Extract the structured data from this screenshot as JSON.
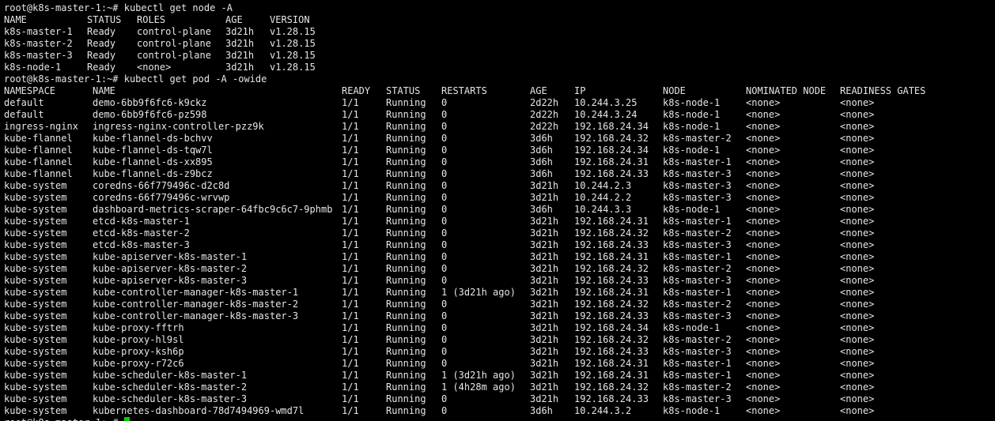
{
  "colors": {
    "background": "#000000",
    "foreground": "#e6e6e6",
    "cursor": "#00d000"
  },
  "prompt": "root@k8s-master-1:~#",
  "cmd_nodes": "kubectl get node -A",
  "node_table": {
    "headers": [
      "NAME",
      "STATUS",
      "ROLES",
      "AGE",
      "VERSION"
    ],
    "rows": [
      [
        "k8s-master-1",
        "Ready",
        "control-plane",
        "3d21h",
        "v1.28.15"
      ],
      [
        "k8s-master-2",
        "Ready",
        "control-plane",
        "3d21h",
        "v1.28.15"
      ],
      [
        "k8s-master-3",
        "Ready",
        "control-plane",
        "3d21h",
        "v1.28.15"
      ],
      [
        "k8s-node-1",
        "Ready",
        "<none>",
        "3d21h",
        "v1.28.15"
      ]
    ]
  },
  "cmd_pods": "kubectl get pod -A -owide",
  "pod_table": {
    "headers": [
      "NAMESPACE",
      "NAME",
      "READY",
      "STATUS",
      "RESTARTS",
      "AGE",
      "IP",
      "NODE",
      "NOMINATED NODE",
      "READINESS GATES"
    ],
    "rows": [
      [
        "default",
        "demo-6bb9f6fc6-k9ckz",
        "1/1",
        "Running",
        "0",
        "2d22h",
        "10.244.3.25",
        "k8s-node-1",
        "<none>",
        "<none>"
      ],
      [
        "default",
        "demo-6bb9f6fc6-pz598",
        "1/1",
        "Running",
        "0",
        "2d22h",
        "10.244.3.24",
        "k8s-node-1",
        "<none>",
        "<none>"
      ],
      [
        "ingress-nginx",
        "ingress-nginx-controller-pzz9k",
        "1/1",
        "Running",
        "0",
        "2d22h",
        "192.168.24.34",
        "k8s-node-1",
        "<none>",
        "<none>"
      ],
      [
        "kube-flannel",
        "kube-flannel-ds-bchvv",
        "1/1",
        "Running",
        "0",
        "3d6h",
        "192.168.24.32",
        "k8s-master-2",
        "<none>",
        "<none>"
      ],
      [
        "kube-flannel",
        "kube-flannel-ds-tqw7l",
        "1/1",
        "Running",
        "0",
        "3d6h",
        "192.168.24.34",
        "k8s-node-1",
        "<none>",
        "<none>"
      ],
      [
        "kube-flannel",
        "kube-flannel-ds-xx895",
        "1/1",
        "Running",
        "0",
        "3d6h",
        "192.168.24.31",
        "k8s-master-1",
        "<none>",
        "<none>"
      ],
      [
        "kube-flannel",
        "kube-flannel-ds-z9bcz",
        "1/1",
        "Running",
        "0",
        "3d6h",
        "192.168.24.33",
        "k8s-master-3",
        "<none>",
        "<none>"
      ],
      [
        "kube-system",
        "coredns-66f779496c-d2c8d",
        "1/1",
        "Running",
        "0",
        "3d21h",
        "10.244.2.3",
        "k8s-master-3",
        "<none>",
        "<none>"
      ],
      [
        "kube-system",
        "coredns-66f779496c-wrvwp",
        "1/1",
        "Running",
        "0",
        "3d21h",
        "10.244.2.2",
        "k8s-master-3",
        "<none>",
        "<none>"
      ],
      [
        "kube-system",
        "dashboard-metrics-scraper-64fbc9c6c7-9phmb",
        "1/1",
        "Running",
        "0",
        "3d6h",
        "10.244.3.3",
        "k8s-node-1",
        "<none>",
        "<none>"
      ],
      [
        "kube-system",
        "etcd-k8s-master-1",
        "1/1",
        "Running",
        "0",
        "3d21h",
        "192.168.24.31",
        "k8s-master-1",
        "<none>",
        "<none>"
      ],
      [
        "kube-system",
        "etcd-k8s-master-2",
        "1/1",
        "Running",
        "0",
        "3d21h",
        "192.168.24.32",
        "k8s-master-2",
        "<none>",
        "<none>"
      ],
      [
        "kube-system",
        "etcd-k8s-master-3",
        "1/1",
        "Running",
        "0",
        "3d21h",
        "192.168.24.33",
        "k8s-master-3",
        "<none>",
        "<none>"
      ],
      [
        "kube-system",
        "kube-apiserver-k8s-master-1",
        "1/1",
        "Running",
        "0",
        "3d21h",
        "192.168.24.31",
        "k8s-master-1",
        "<none>",
        "<none>"
      ],
      [
        "kube-system",
        "kube-apiserver-k8s-master-2",
        "1/1",
        "Running",
        "0",
        "3d21h",
        "192.168.24.32",
        "k8s-master-2",
        "<none>",
        "<none>"
      ],
      [
        "kube-system",
        "kube-apiserver-k8s-master-3",
        "1/1",
        "Running",
        "0",
        "3d21h",
        "192.168.24.33",
        "k8s-master-3",
        "<none>",
        "<none>"
      ],
      [
        "kube-system",
        "kube-controller-manager-k8s-master-1",
        "1/1",
        "Running",
        "1 (3d21h ago)",
        "3d21h",
        "192.168.24.31",
        "k8s-master-1",
        "<none>",
        "<none>"
      ],
      [
        "kube-system",
        "kube-controller-manager-k8s-master-2",
        "1/1",
        "Running",
        "0",
        "3d21h",
        "192.168.24.32",
        "k8s-master-2",
        "<none>",
        "<none>"
      ],
      [
        "kube-system",
        "kube-controller-manager-k8s-master-3",
        "1/1",
        "Running",
        "0",
        "3d21h",
        "192.168.24.33",
        "k8s-master-3",
        "<none>",
        "<none>"
      ],
      [
        "kube-system",
        "kube-proxy-fftrh",
        "1/1",
        "Running",
        "0",
        "3d21h",
        "192.168.24.34",
        "k8s-node-1",
        "<none>",
        "<none>"
      ],
      [
        "kube-system",
        "kube-proxy-hl9sl",
        "1/1",
        "Running",
        "0",
        "3d21h",
        "192.168.24.32",
        "k8s-master-2",
        "<none>",
        "<none>"
      ],
      [
        "kube-system",
        "kube-proxy-ksh6p",
        "1/1",
        "Running",
        "0",
        "3d21h",
        "192.168.24.33",
        "k8s-master-3",
        "<none>",
        "<none>"
      ],
      [
        "kube-system",
        "kube-proxy-r72c6",
        "1/1",
        "Running",
        "0",
        "3d21h",
        "192.168.24.31",
        "k8s-master-1",
        "<none>",
        "<none>"
      ],
      [
        "kube-system",
        "kube-scheduler-k8s-master-1",
        "1/1",
        "Running",
        "1 (3d21h ago)",
        "3d21h",
        "192.168.24.31",
        "k8s-master-1",
        "<none>",
        "<none>"
      ],
      [
        "kube-system",
        "kube-scheduler-k8s-master-2",
        "1/1",
        "Running",
        "1 (4h28m ago)",
        "3d21h",
        "192.168.24.32",
        "k8s-master-2",
        "<none>",
        "<none>"
      ],
      [
        "kube-system",
        "kube-scheduler-k8s-master-3",
        "1/1",
        "Running",
        "0",
        "3d21h",
        "192.168.24.33",
        "k8s-master-3",
        "<none>",
        "<none>"
      ],
      [
        "kube-system",
        "kubernetes-dashboard-78d7494969-wmd7l",
        "1/1",
        "Running",
        "0",
        "3d6h",
        "10.244.3.2",
        "k8s-node-1",
        "<none>",
        "<none>"
      ]
    ]
  }
}
